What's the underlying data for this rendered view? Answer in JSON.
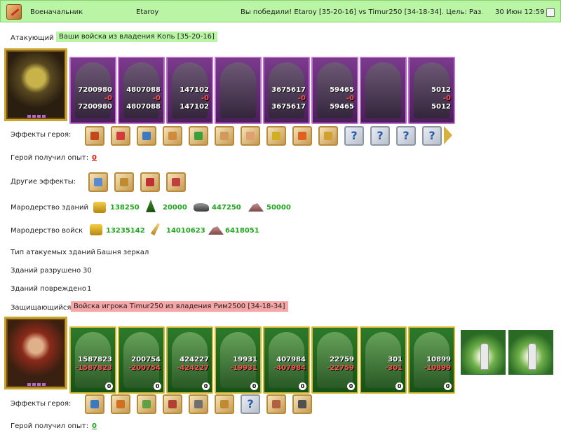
{
  "header": {
    "title": "Военачальник",
    "user": "Etaroy",
    "message": "Вы победили! Etaroy [35-20-16] vs Timur250 [34-18-34]. Цель: Раз...",
    "date": "30 Июн 12:59",
    "icon": "battle-swords-icon"
  },
  "attacker": {
    "label": "Атакующий",
    "source": "Ваши войска из владения Копь [35-20-16]",
    "units": [
      {
        "c1": "7200980",
        "c2": "-0",
        "c3": "7200980"
      },
      {
        "c1": "4807088",
        "c2": "-0",
        "c3": "4807088"
      },
      {
        "c1": "147102",
        "c2": "-0",
        "c3": "147102"
      },
      {
        "c1": "",
        "c2": "",
        "c3": ""
      },
      {
        "c1": "3675617",
        "c2": "-0",
        "c3": "3675617"
      },
      {
        "c1": "59465",
        "c2": "-0",
        "c3": "59465"
      },
      {
        "c1": "",
        "c2": "",
        "c3": ""
      },
      {
        "c1": "5012",
        "c2": "-0",
        "c3": "5012"
      }
    ],
    "hero_effects_label": "Эффекты героя:",
    "exp_label": "Герой получил опыт:",
    "exp_value": "0",
    "other_effects_label": "Другие эффекты:",
    "loot_buildings_label": "Мародерство зданий",
    "loot_buildings": {
      "gold": "138250",
      "wood": "20000",
      "ore": "447250",
      "stone": "50000"
    },
    "loot_troops_label": "Мародерство войск",
    "loot_troops": {
      "gold": "13235142",
      "grain": "14010623",
      "stone": "6418051"
    },
    "target_type_label": "Тип атакуемых зданий",
    "target_type_value": "Башня зеркал",
    "destroyed_label": "Зданий разрушено",
    "destroyed_value": "30",
    "damaged_label": "Зданий повреждено",
    "damaged_value": "1"
  },
  "defender": {
    "label": "Защищающийся",
    "source": "Войска игрока Timur250 из владения Рим2500 [34-18-34]",
    "units": [
      {
        "c1": "1587823",
        "c2": "-1587823",
        "c3": "0"
      },
      {
        "c1": "200754",
        "c2": "-200754",
        "c3": "0"
      },
      {
        "c1": "424227",
        "c2": "-424227",
        "c3": "0"
      },
      {
        "c1": "19931",
        "c2": "-19931",
        "c3": "0"
      },
      {
        "c1": "407984",
        "c2": "-407984",
        "c3": "0"
      },
      {
        "c1": "22759",
        "c2": "-22759",
        "c3": "0"
      },
      {
        "c1": "301",
        "c2": "-301",
        "c3": "0"
      },
      {
        "c1": "10899",
        "c2": "-10899",
        "c3": "0"
      }
    ],
    "hero_effects_label": "Эффекты героя:",
    "exp_label": "Герой получил опыт:",
    "exp_value": "0"
  },
  "colors": {
    "win_bg": "#b9f5a4",
    "lose_bg": "#f6a6a6",
    "green_value": "#21a51f",
    "red_value": "#e01818"
  }
}
